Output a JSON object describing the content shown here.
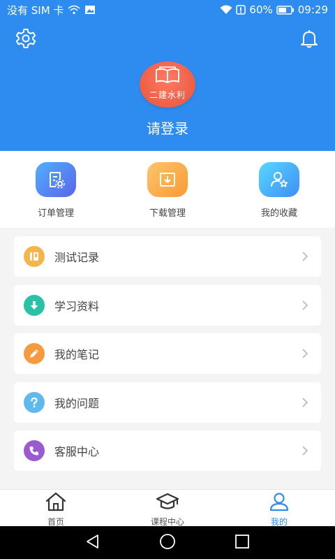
{
  "status_bar": {
    "carrier": "没有 SIM 卡",
    "battery": "60%",
    "time": "09:29"
  },
  "header": {
    "avatar_text": "二建水利",
    "login_text": "请登录"
  },
  "quick_actions": [
    {
      "label": "订单管理",
      "icon": "order-settings-icon"
    },
    {
      "label": "下载管理",
      "icon": "download-icon"
    },
    {
      "label": "我的收藏",
      "icon": "favorites-icon"
    }
  ],
  "menu": [
    {
      "label": "测试记录",
      "icon": "test-record-icon"
    },
    {
      "label": "学习资料",
      "icon": "study-material-icon"
    },
    {
      "label": "我的笔记",
      "icon": "notes-icon"
    },
    {
      "label": "我的问题",
      "icon": "question-icon"
    },
    {
      "label": "客服中心",
      "icon": "customer-service-icon"
    }
  ],
  "tabs": [
    {
      "label": "首页",
      "icon": "home-icon",
      "active": false
    },
    {
      "label": "课程中心",
      "icon": "graduation-cap-icon",
      "active": false
    },
    {
      "label": "我的",
      "icon": "user-icon",
      "active": true
    }
  ],
  "colors": {
    "primary": "#2e8cf0",
    "avatar": "#e5533b"
  }
}
